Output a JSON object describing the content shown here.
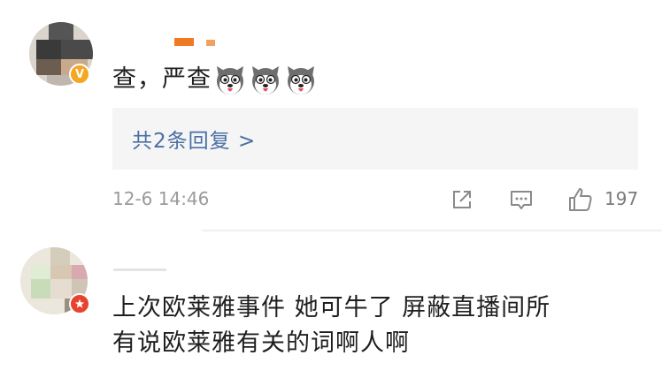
{
  "comments": [
    {
      "text": "查，严查",
      "emoji_name": "husky-emoji",
      "emoji_count": 3,
      "reply_link": "共2条回复 >",
      "time": "12-6 14:46",
      "likes": "197",
      "badge": "V",
      "colors": {
        "badge": "#f5a623"
      }
    },
    {
      "text_line1": "上次欧莱雅事件 她可牛了 屏蔽直播间所",
      "text_line2": "有说欧莱雅有关的词啊人啊",
      "badge_icon": "star-icon",
      "colors": {
        "badge": "#e8432f"
      }
    }
  ],
  "icons": {
    "share": "share-icon",
    "comment": "comment-icon",
    "like": "thumbs-up-icon"
  },
  "colors": {
    "link": "#4a6fa5",
    "reply_bg": "#f5f5f5",
    "meta": "#9a9a9a"
  }
}
